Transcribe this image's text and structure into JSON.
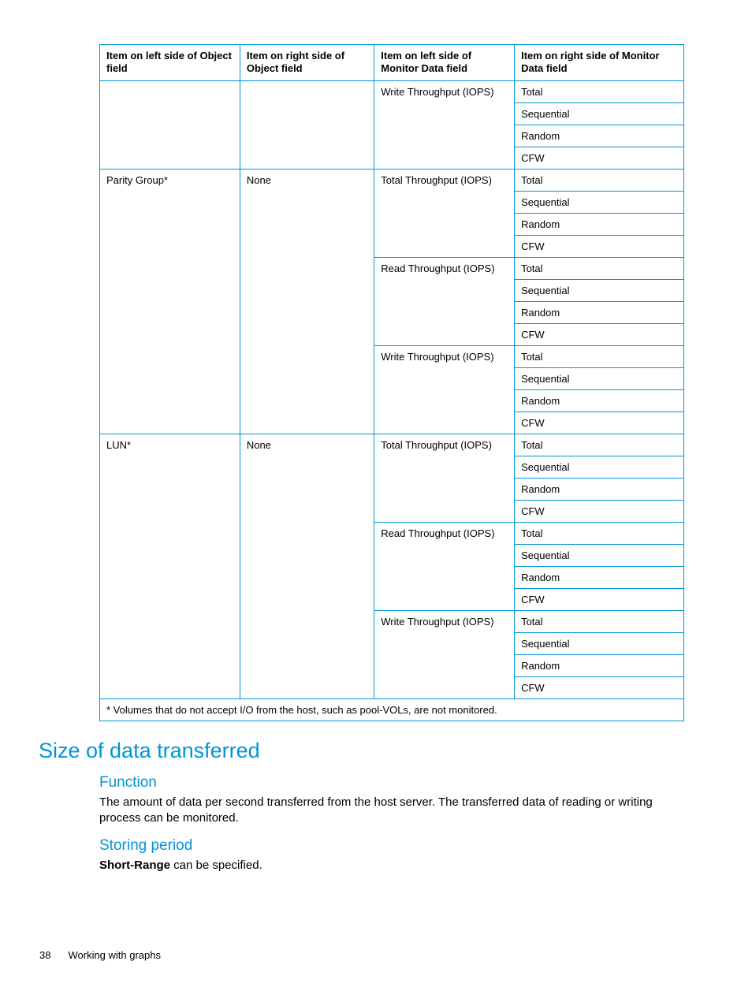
{
  "table": {
    "headers": [
      "Item on left side of Object field",
      "Item on right side of Object field",
      "Item on left side of Monitor Data field",
      "Item on right side of Monitor Data field"
    ],
    "subvals": [
      "Total",
      "Sequential",
      "Random",
      "CFW"
    ],
    "group0": {
      "col3": "Write Throughput (IOPS)"
    },
    "group1": {
      "col1": "Parity Group*",
      "col2": "None",
      "m": [
        "Total Throughput (IOPS)",
        "Read Throughput (IOPS)",
        "Write Throughput (IOPS)"
      ]
    },
    "group2": {
      "col1": "LUN*",
      "col2": "None",
      "m": [
        "Total Throughput (IOPS)",
        "Read Throughput (IOPS)",
        "Write Throughput (IOPS)"
      ]
    },
    "footnote": "* Volumes that do not accept I/O from the host, such as pool-VOLs, are not monitored."
  },
  "section": {
    "title": "Size of data transferred",
    "function_heading": "Function",
    "function_body": "The amount of data per second transferred from the host server. The transferred data of reading or writing process can be monitored.",
    "storing_heading": "Storing period",
    "storing_strong": "Short-Range",
    "storing_rest": " can be specified."
  },
  "footer": {
    "page": "38",
    "chapter": "Working with graphs"
  }
}
